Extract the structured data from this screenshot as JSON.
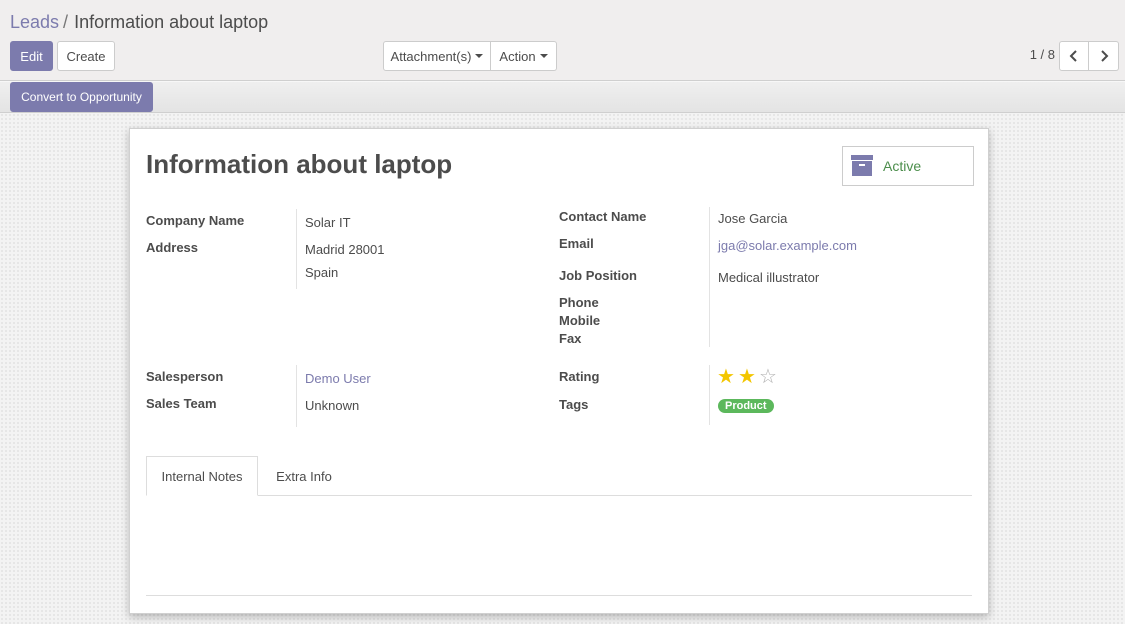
{
  "breadcrumb": {
    "parent": "Leads",
    "separator": "/",
    "current": "Information about laptop"
  },
  "toolbar": {
    "edit_label": "Edit",
    "create_label": "Create",
    "attachments_label": "Attachment(s)",
    "action_label": "Action"
  },
  "pager": {
    "value": "1 / 8",
    "prev_icon": "chevron-left-icon",
    "next_icon": "chevron-right-icon"
  },
  "statusbar": {
    "convert_label": "Convert to Opportunity"
  },
  "sheet": {
    "title": "Information about laptop",
    "active_button": {
      "label": "Active",
      "icon": "archive-icon"
    },
    "left": {
      "company_name_label": "Company Name",
      "company_name_value": "Solar IT",
      "address_label": "Address",
      "address_line1": "Madrid 28001",
      "address_line2": "Spain",
      "salesperson_label": "Salesperson",
      "salesperson_value": "Demo User",
      "sales_team_label": "Sales Team",
      "sales_team_value": "Unknown"
    },
    "right": {
      "contact_name_label": "Contact Name",
      "contact_name_value": "Jose Garcia",
      "email_label": "Email",
      "email_value": "jga@solar.example.com",
      "job_position_label": "Job Position",
      "job_position_value": "Medical illustrator",
      "phone_label": "Phone",
      "mobile_label": "Mobile",
      "fax_label": "Fax",
      "rating_label": "Rating",
      "rating_value": 2,
      "rating_max": 3,
      "tags_label": "Tags",
      "tag_value": "Product"
    },
    "tabs": [
      {
        "label": "Internal Notes",
        "active": true
      },
      {
        "label": "Extra Info",
        "active": false
      }
    ]
  },
  "colors": {
    "primary": "#7c7bad",
    "active_text": "#4c8e4c",
    "tag_bg": "#5cb85c",
    "star_on": "#f3c600"
  }
}
